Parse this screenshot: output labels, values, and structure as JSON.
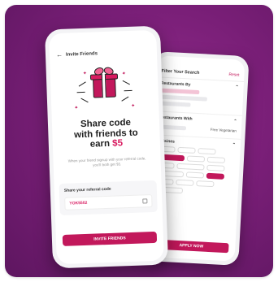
{
  "colors": {
    "background": "#7a1f78",
    "accent": "#c2185b"
  },
  "front_phone": {
    "header_title": "Invite Friends",
    "headline_line1": "Share code",
    "headline_line2": "with friends to",
    "headline_line3_prefix": "earn ",
    "headline_amount": "$5",
    "description": "When your friend signup with your referral code, you'll both get $5.",
    "code_label": "Share your referral code",
    "referral_code": "YOK5502",
    "invite_button": "INVITE FRIENDS"
  },
  "back_phone": {
    "header_title": "Filter Your Search",
    "reset_label": "Reset",
    "section1_title": "Restaurants By",
    "section2_title": "Restaurants With",
    "section2_option": "Free Vegetarian",
    "section3_title": "Cuisines",
    "apply_button": "APPLY NOW"
  },
  "icons": [
    "back-arrow-icon",
    "gift-icon",
    "copy-icon"
  ]
}
